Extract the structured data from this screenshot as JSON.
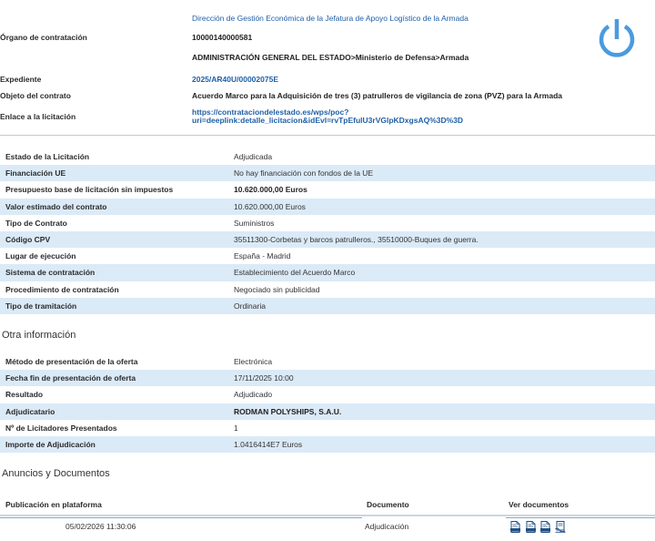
{
  "header": {
    "department": "Dirección de Gestión Económica de la Jefatura de Apoyo Logístico de la Armada",
    "organo_label": "Órgano de contratación",
    "organo_code": "10000140000581",
    "organo_path": "ADMINISTRACIÓN GENERAL DEL ESTADO>Ministerio de Defensa>Armada",
    "expediente_label": "Expediente",
    "expediente_value": "2025/AR40U/00002075E",
    "objeto_label": "Objeto del contrato",
    "objeto_value": "Acuerdo Marco para la Adquisición de tres (3) patrulleros de vigilancia de zona (PVZ) para la Armada",
    "enlace_label": "Enlace a la licitación",
    "enlace_line1": "https://contrataciondelestado.es/wps/poc?",
    "enlace_line2": "uri=deeplink:detalle_licitacion&idEvl=rvTpEfulU3rVGlpKDxgsAQ%3D%3D",
    "power_icon": "power-icon",
    "accent_color": "#4a9be0"
  },
  "details": [
    {
      "label": "Estado de la Licitación",
      "value": "Adjudicada",
      "bold": false
    },
    {
      "label": "Financiación UE",
      "value": "No hay financiación con fondos de la UE",
      "bold": false
    },
    {
      "label": "Presupuesto base de licitación sin impuestos",
      "value": "10.620.000,00 Euros",
      "bold": true
    },
    {
      "label": "Valor estimado del contrato",
      "value": "10.620.000,00 Euros",
      "bold": false
    },
    {
      "label": "Tipo de Contrato",
      "value": "Suministros",
      "bold": false
    },
    {
      "label": "Código CPV",
      "value": "35511300-Corbetas y barcos patrulleros., 35510000-Buques de guerra.",
      "bold": false
    },
    {
      "label": "Lugar de ejecución",
      "value": "España - Madrid",
      "bold": false
    },
    {
      "label": "Sistema de contratación",
      "value": "Establecimiento del Acuerdo Marco",
      "bold": false
    },
    {
      "label": "Procedimiento de contratación",
      "value": "Negociado sin publicidad",
      "bold": false
    },
    {
      "label": "Tipo de tramitación",
      "value": "Ordinaria",
      "bold": false
    }
  ],
  "otra": {
    "title": "Otra información",
    "rows": [
      {
        "label": "Método de presentación de la oferta",
        "value": "Electrónica",
        "bold": false
      },
      {
        "label": "Fecha fin de presentación de oferta",
        "value": "17/11/2025 10:00",
        "bold": false
      },
      {
        "label": "Resultado",
        "value": "Adjudicado",
        "bold": false
      },
      {
        "label": "Adjudicatario",
        "value": "RODMAN POLYSHIPS, S.A.U.",
        "bold": true
      },
      {
        "label": "Nº de Licitadores Presentados",
        "value": "1",
        "bold": false
      },
      {
        "label": "Importe de Adjudicación",
        "value": "1.0416414E7 Euros",
        "bold": false
      }
    ]
  },
  "anuncios": {
    "title": "Anuncios y Documentos",
    "col_publicacion": "Publicación en plataforma",
    "col_documento": "Documento",
    "col_ver": "Ver documentos",
    "rows": [
      {
        "fecha": "05/02/2026 11:30:06",
        "documento": "Adjudicación",
        "icons": [
          "html-doc-icon",
          "xml-doc-icon",
          "pdf-doc-icon",
          "signed-doc-icon"
        ]
      }
    ]
  }
}
